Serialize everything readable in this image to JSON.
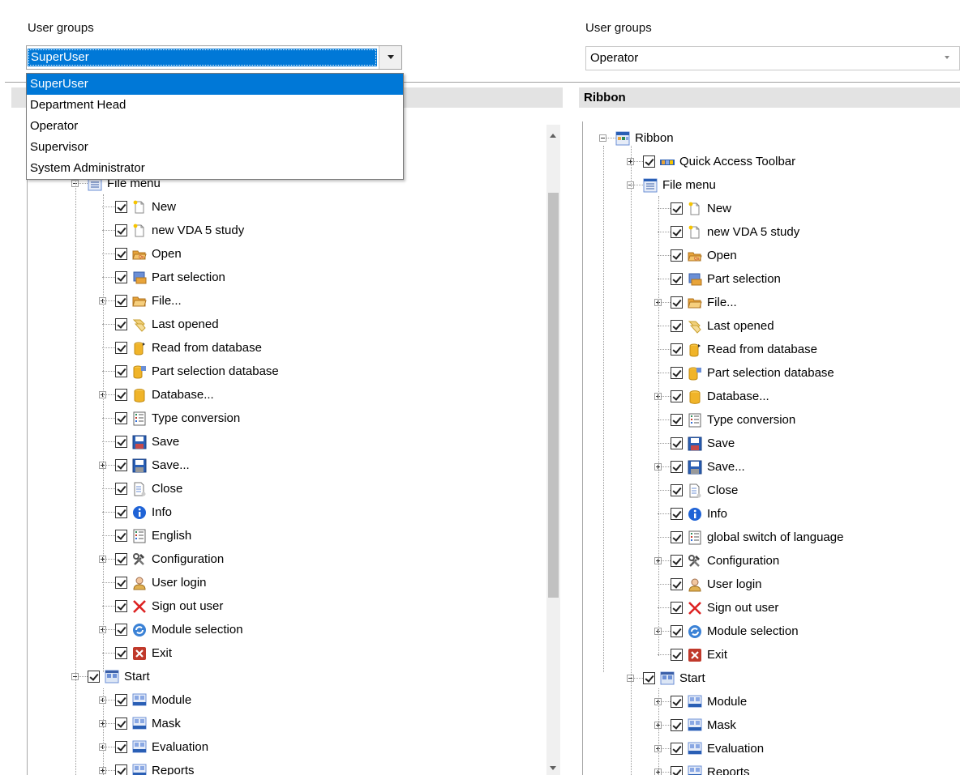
{
  "left": {
    "group_label": "User groups",
    "selected_group": "SuperUser",
    "dropdown_options": [
      "SuperUser",
      "Department Head",
      "Operator",
      "Supervisor",
      "System Administrator"
    ]
  },
  "right": {
    "group_label": "User groups",
    "selected_group": "Operator",
    "section_title": "Ribbon"
  },
  "tree_left": [
    {
      "text": "File menu",
      "level": 2,
      "expander": "minus",
      "checkbox": false,
      "icon": "file-menu-icon"
    },
    {
      "text": "New",
      "level": 3,
      "expander": "",
      "checkbox": true,
      "icon": "new-document-icon"
    },
    {
      "text": "new VDA 5 study",
      "level": 3,
      "expander": "",
      "checkbox": true,
      "icon": "new-document-icon"
    },
    {
      "text": "Open",
      "level": 3,
      "expander": "",
      "checkbox": true,
      "icon": "open-folder-icon"
    },
    {
      "text": "Part selection",
      "level": 3,
      "expander": "",
      "checkbox": true,
      "icon": "part-selection-icon"
    },
    {
      "text": "File...",
      "level": 3,
      "expander": "plus",
      "checkbox": true,
      "icon": "folder-icon"
    },
    {
      "text": "Last opened",
      "level": 3,
      "expander": "",
      "checkbox": true,
      "icon": "last-opened-icon"
    },
    {
      "text": "Read from database",
      "level": 3,
      "expander": "",
      "checkbox": true,
      "icon": "database-read-icon"
    },
    {
      "text": "Part selection database",
      "level": 3,
      "expander": "",
      "checkbox": true,
      "icon": "database-part-icon"
    },
    {
      "text": "Database...",
      "level": 3,
      "expander": "plus",
      "checkbox": true,
      "icon": "database-icon"
    },
    {
      "text": "Type conversion",
      "level": 3,
      "expander": "",
      "checkbox": true,
      "icon": "list-icon"
    },
    {
      "text": "Save",
      "level": 3,
      "expander": "",
      "checkbox": true,
      "icon": "save-icon"
    },
    {
      "text": "Save...",
      "level": 3,
      "expander": "plus",
      "checkbox": true,
      "icon": "save-as-icon"
    },
    {
      "text": "Close",
      "level": 3,
      "expander": "",
      "checkbox": true,
      "icon": "close-document-icon"
    },
    {
      "text": "Info",
      "level": 3,
      "expander": "",
      "checkbox": true,
      "icon": "info-icon"
    },
    {
      "text": "English",
      "level": 3,
      "expander": "",
      "checkbox": true,
      "icon": "list-icon"
    },
    {
      "text": "Configuration",
      "level": 3,
      "expander": "plus",
      "checkbox": true,
      "icon": "tools-icon"
    },
    {
      "text": "User login",
      "level": 3,
      "expander": "",
      "checkbox": true,
      "icon": "user-icon"
    },
    {
      "text": "Sign out user",
      "level": 3,
      "expander": "",
      "checkbox": true,
      "icon": "sign-out-icon"
    },
    {
      "text": "Module selection",
      "level": 3,
      "expander": "plus",
      "checkbox": true,
      "icon": "refresh-icon"
    },
    {
      "text": "Exit",
      "level": 3,
      "expander": "",
      "checkbox": true,
      "icon": "exit-icon"
    },
    {
      "text": "Start",
      "level": 2,
      "expander": "minus",
      "checkbox": true,
      "icon": "start-page-icon"
    },
    {
      "text": "Module",
      "level": 3,
      "expander": "plus",
      "checkbox": true,
      "icon": "toolbar-icon"
    },
    {
      "text": "Mask",
      "level": 3,
      "expander": "plus",
      "checkbox": true,
      "icon": "toolbar-icon"
    },
    {
      "text": "Evaluation",
      "level": 3,
      "expander": "plus",
      "checkbox": true,
      "icon": "toolbar-icon"
    },
    {
      "text": "Reports",
      "level": 3,
      "expander": "plus",
      "checkbox": true,
      "icon": "toolbar-icon"
    }
  ],
  "tree_right": [
    {
      "text": "Ribbon",
      "level": 1,
      "expander": "minus",
      "checkbox": false,
      "icon": "ribbon-icon"
    },
    {
      "text": "Quick Access Toolbar",
      "level": 2,
      "expander": "plus",
      "checkbox": true,
      "icon": "quick-access-icon"
    },
    {
      "text": "File menu",
      "level": 2,
      "expander": "minus",
      "checkbox": false,
      "icon": "file-menu-icon"
    },
    {
      "text": "New",
      "level": 3,
      "expander": "",
      "checkbox": true,
      "icon": "new-document-icon"
    },
    {
      "text": "new VDA 5 study",
      "level": 3,
      "expander": "",
      "checkbox": true,
      "icon": "new-document-icon"
    },
    {
      "text": "Open",
      "level": 3,
      "expander": "",
      "checkbox": true,
      "icon": "open-folder-icon"
    },
    {
      "text": "Part selection",
      "level": 3,
      "expander": "",
      "checkbox": true,
      "icon": "part-selection-icon"
    },
    {
      "text": "File...",
      "level": 3,
      "expander": "plus",
      "checkbox": true,
      "icon": "folder-icon"
    },
    {
      "text": "Last opened",
      "level": 3,
      "expander": "",
      "checkbox": true,
      "icon": "last-opened-icon"
    },
    {
      "text": "Read from database",
      "level": 3,
      "expander": "",
      "checkbox": true,
      "icon": "database-read-icon"
    },
    {
      "text": "Part selection database",
      "level": 3,
      "expander": "",
      "checkbox": true,
      "icon": "database-part-icon"
    },
    {
      "text": "Database...",
      "level": 3,
      "expander": "plus",
      "checkbox": true,
      "icon": "database-icon"
    },
    {
      "text": "Type conversion",
      "level": 3,
      "expander": "",
      "checkbox": true,
      "icon": "list-icon"
    },
    {
      "text": "Save",
      "level": 3,
      "expander": "",
      "checkbox": true,
      "icon": "save-icon"
    },
    {
      "text": "Save...",
      "level": 3,
      "expander": "plus",
      "checkbox": true,
      "icon": "save-as-icon"
    },
    {
      "text": "Close",
      "level": 3,
      "expander": "",
      "checkbox": true,
      "icon": "close-document-icon"
    },
    {
      "text": "Info",
      "level": 3,
      "expander": "",
      "checkbox": true,
      "icon": "info-icon"
    },
    {
      "text": "global switch of language",
      "level": 3,
      "expander": "",
      "checkbox": true,
      "icon": "list-icon"
    },
    {
      "text": "Configuration",
      "level": 3,
      "expander": "plus",
      "checkbox": true,
      "icon": "tools-icon"
    },
    {
      "text": "User login",
      "level": 3,
      "expander": "",
      "checkbox": true,
      "icon": "user-icon"
    },
    {
      "text": "Sign out user",
      "level": 3,
      "expander": "",
      "checkbox": true,
      "icon": "sign-out-icon"
    },
    {
      "text": "Module selection",
      "level": 3,
      "expander": "plus",
      "checkbox": true,
      "icon": "refresh-icon"
    },
    {
      "text": "Exit",
      "level": 3,
      "expander": "",
      "checkbox": true,
      "icon": "exit-icon"
    },
    {
      "text": "Start",
      "level": 2,
      "expander": "minus",
      "checkbox": true,
      "icon": "start-page-icon"
    },
    {
      "text": "Module",
      "level": 3,
      "expander": "plus",
      "checkbox": true,
      "icon": "toolbar-icon"
    },
    {
      "text": "Mask",
      "level": 3,
      "expander": "plus",
      "checkbox": true,
      "icon": "toolbar-icon"
    },
    {
      "text": "Evaluation",
      "level": 3,
      "expander": "plus",
      "checkbox": true,
      "icon": "toolbar-icon"
    },
    {
      "text": "Reports",
      "level": 3,
      "expander": "plus",
      "checkbox": true,
      "icon": "toolbar-icon"
    }
  ],
  "colors": {
    "selection": "#0078d7",
    "section_header": "#e3e3e3",
    "scrollbar_thumb": "#c1c1c1"
  }
}
